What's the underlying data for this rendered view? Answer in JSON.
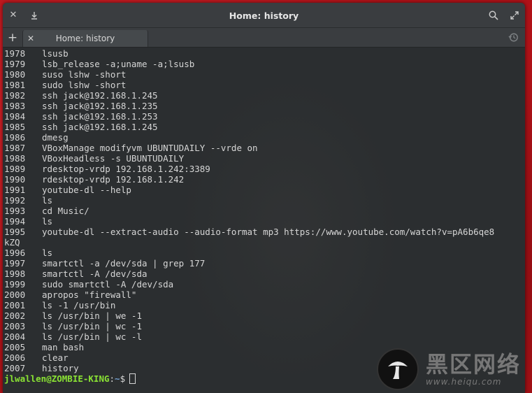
{
  "window": {
    "title": "Home: history"
  },
  "tabs": [
    {
      "label": "Home: history"
    }
  ],
  "history": [
    {
      "n": "1978",
      "cmd": "lsusb"
    },
    {
      "n": "1979",
      "cmd": "lsb_release -a;uname -a;lsusb"
    },
    {
      "n": "1980",
      "cmd": "suso lshw -short"
    },
    {
      "n": "1981",
      "cmd": "sudo lshw -short"
    },
    {
      "n": "1982",
      "cmd": "ssh jack@192.168.1.245"
    },
    {
      "n": "1983",
      "cmd": "ssh jack@192.168.1.235"
    },
    {
      "n": "1984",
      "cmd": "ssh jack@192.168.1.253"
    },
    {
      "n": "1985",
      "cmd": "ssh jack@192.168.1.245"
    },
    {
      "n": "1986",
      "cmd": "dmesg"
    },
    {
      "n": "1987",
      "cmd": "VBoxManage modifyvm UBUNTUDAILY --vrde on"
    },
    {
      "n": "1988",
      "cmd": "VBoxHeadless -s UBUNTUDAILY"
    },
    {
      "n": "1989",
      "cmd": "rdesktop-vrdp 192.168.1.242:3389"
    },
    {
      "n": "1990",
      "cmd": "rdesktop-vrdp 192.168.1.242"
    },
    {
      "n": "1991",
      "cmd": "youtube-dl --help"
    },
    {
      "n": "1992",
      "cmd": "ls"
    },
    {
      "n": "1993",
      "cmd": "cd Music/"
    },
    {
      "n": "1994",
      "cmd": "ls"
    },
    {
      "n": "1995",
      "cmd": "youtube-dl --extract-audio --audio-format mp3 https://www.youtube.com/watch?v=pA6b6qe8",
      "wrap": "kZQ"
    },
    {
      "n": "1996",
      "cmd": "ls"
    },
    {
      "n": "1997",
      "cmd": "smartctl -a /dev/sda | grep 177"
    },
    {
      "n": "1998",
      "cmd": "smartctl -A /dev/sda"
    },
    {
      "n": "1999",
      "cmd": "sudo smartctl -A /dev/sda"
    },
    {
      "n": "2000",
      "cmd": "apropos \"firewall\""
    },
    {
      "n": "2001",
      "cmd": "ls -1 /usr/bin"
    },
    {
      "n": "2002",
      "cmd": "ls /usr/bin | we -1"
    },
    {
      "n": "2003",
      "cmd": "ls /usr/bin | wc -1"
    },
    {
      "n": "2004",
      "cmd": "ls /usr/bin | wc -l"
    },
    {
      "n": "2005",
      "cmd": "man bash"
    },
    {
      "n": "2006",
      "cmd": "clear"
    },
    {
      "n": "2007",
      "cmd": "history"
    }
  ],
  "prompt": {
    "user_host": "jlwallen@ZOMBIE-KING",
    "colon": ":",
    "path": "~",
    "symbol": "$"
  },
  "watermark": {
    "cn": "黑区网络",
    "url": "www.heiqu.com"
  },
  "colors": {
    "prompt_user": "#8ae234",
    "prompt_path": "#729fcf",
    "terminal_bg": "#2b2e30",
    "desktop_bg": "#b01218"
  }
}
